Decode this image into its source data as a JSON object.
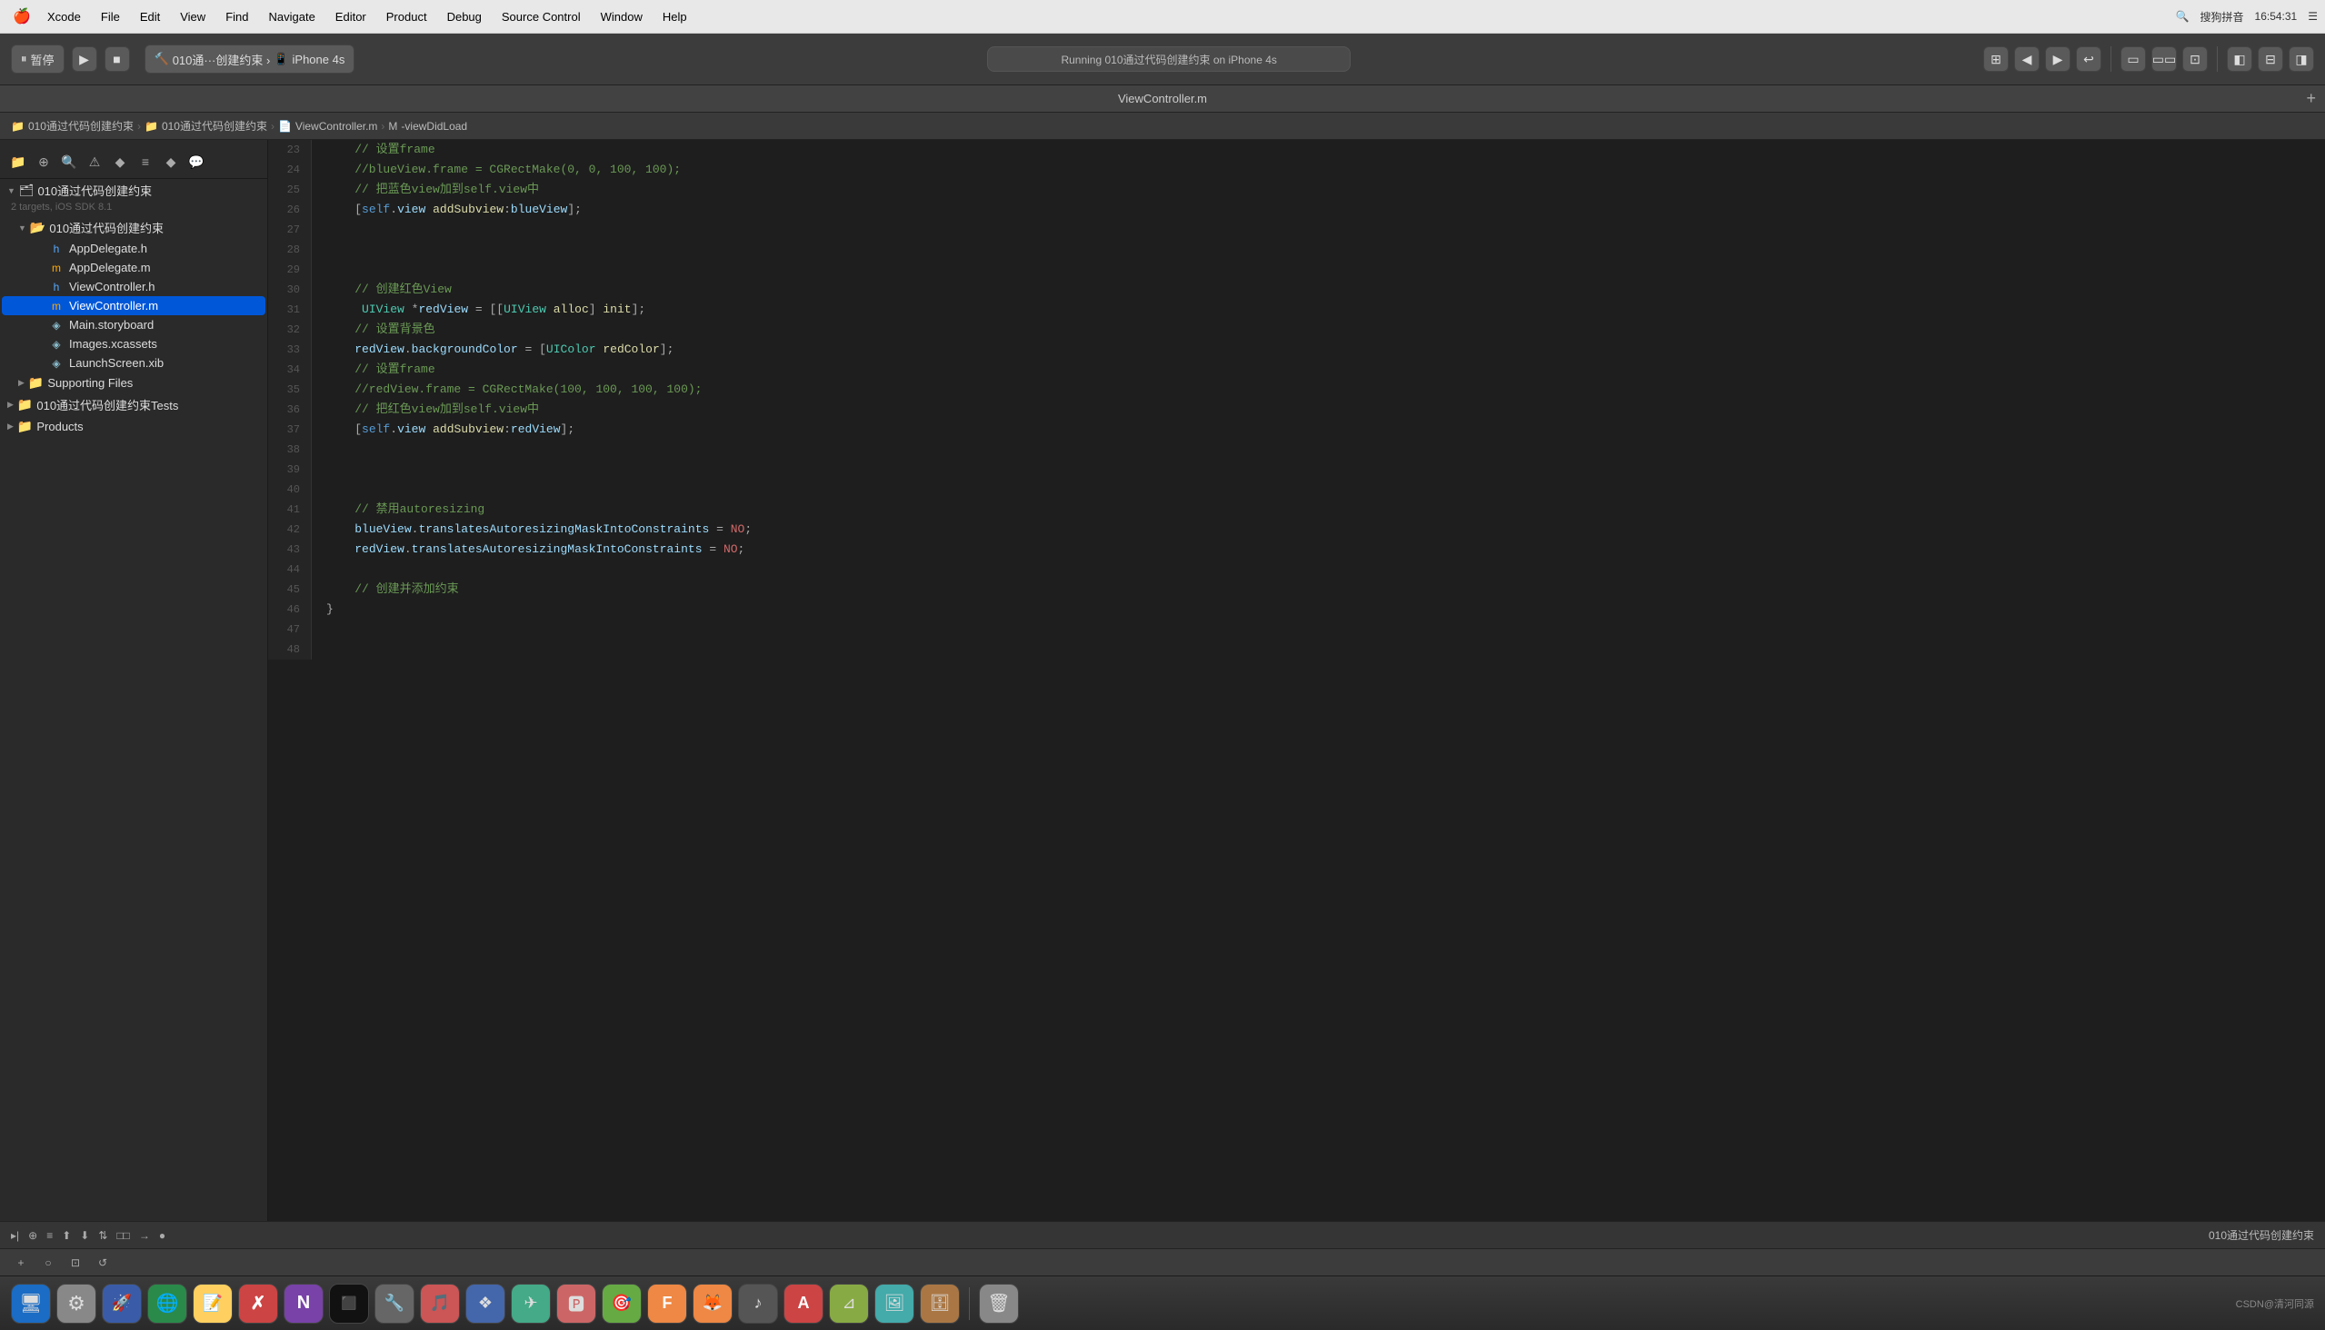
{
  "menubar": {
    "apple": "🍎",
    "items": [
      "Xcode",
      "File",
      "Edit",
      "View",
      "Find",
      "Navigate",
      "Editor",
      "Product",
      "Debug",
      "Source Control",
      "Window",
      "Help"
    ],
    "right": {
      "time": "16:54:31",
      "input_method": "搜狗拼音"
    }
  },
  "toolbar": {
    "stop_label": "暂停",
    "run_icon": "▶",
    "stop_icon": "■",
    "device": "iPhone 4s",
    "status": "Running 010通过代码创建约束 on iPhone 4s",
    "icons": [
      "⊞",
      "◀",
      "▶",
      "≡",
      "⊙",
      "□",
      "⊡",
      "▦"
    ]
  },
  "tabbar": {
    "title": "ViewController.m",
    "add": "+"
  },
  "breadcrumb": {
    "items": [
      "010通过代码创建约束",
      "010通过代码创建约束",
      "ViewController.m",
      "-viewDidLoad"
    ]
  },
  "sidebar": {
    "toolbar_icons": [
      "📁",
      "⊕",
      "🔍",
      "⚠",
      "◆",
      "≡",
      "♦",
      "💬"
    ],
    "project": {
      "name": "010通过代码创建约束",
      "meta": "2 targets, iOS SDK 8.1",
      "groups": [
        {
          "name": "010通过代码创建约束",
          "expanded": true,
          "items": [
            {
              "name": "AppDelegate.h",
              "icon": "h",
              "type": "header"
            },
            {
              "name": "AppDelegate.m",
              "icon": "m",
              "type": "source"
            },
            {
              "name": "ViewController.h",
              "icon": "h",
              "type": "header"
            },
            {
              "name": "ViewController.m",
              "icon": "m",
              "type": "source",
              "selected": true
            },
            {
              "name": "Main.storyboard",
              "icon": "◈",
              "type": "storyboard"
            },
            {
              "name": "Images.xcassets",
              "icon": "◈",
              "type": "assets"
            },
            {
              "name": "LaunchScreen.xib",
              "icon": "◈",
              "type": "xib"
            }
          ]
        },
        {
          "name": "Supporting Files",
          "expanded": false,
          "items": []
        },
        {
          "name": "010通过代码创建约束Tests",
          "expanded": false,
          "items": []
        },
        {
          "name": "Products",
          "expanded": false,
          "items": []
        }
      ]
    }
  },
  "editor": {
    "lines": [
      {
        "num": 23,
        "content": "    // 设置frame",
        "type": "comment"
      },
      {
        "num": 24,
        "content": "    //blueView.frame = CGRectMake(0, 0, 100, 100);",
        "type": "comment"
      },
      {
        "num": 25,
        "content": "    // 把蓝色view加到self.view中",
        "type": "comment"
      },
      {
        "num": 26,
        "content": "    [self.view addSubview:blueView];",
        "type": "code"
      },
      {
        "num": 27,
        "content": ""
      },
      {
        "num": 28,
        "content": ""
      },
      {
        "num": 29,
        "content": ""
      },
      {
        "num": 30,
        "content": "    // 创建红色View",
        "type": "comment"
      },
      {
        "num": 31,
        "content": "     UIView *redView = [[UIView alloc] init];",
        "type": "code"
      },
      {
        "num": 32,
        "content": "    // 设置背景色",
        "type": "comment"
      },
      {
        "num": 33,
        "content": "    redView.backgroundColor = [UIColor redColor];",
        "type": "code"
      },
      {
        "num": 34,
        "content": "    // 设置frame",
        "type": "comment"
      },
      {
        "num": 35,
        "content": "    //redView.frame = CGRectMake(100, 100, 100, 100);",
        "type": "comment"
      },
      {
        "num": 36,
        "content": "    // 把红色view加到self.view中",
        "type": "comment"
      },
      {
        "num": 37,
        "content": "    [self.view addSubview:redView];",
        "type": "code"
      },
      {
        "num": 38,
        "content": ""
      },
      {
        "num": 39,
        "content": ""
      },
      {
        "num": 40,
        "content": ""
      },
      {
        "num": 41,
        "content": "    // 禁用autoresizing",
        "type": "comment"
      },
      {
        "num": 42,
        "content": "    blueView.translatesAutoresizingMaskIntoConstraints = NO;",
        "type": "code"
      },
      {
        "num": 43,
        "content": "    redView.translatesAutoresizingMaskIntoConstraints = NO;",
        "type": "code"
      },
      {
        "num": 44,
        "content": ""
      },
      {
        "num": 45,
        "content": "    // 创建并添加约束",
        "type": "comment"
      },
      {
        "num": 46,
        "content": "}"
      },
      {
        "num": 47,
        "content": ""
      },
      {
        "num": 48,
        "content": ""
      }
    ]
  },
  "debug_bar": {
    "icons": [
      "▸|",
      "⊕",
      "📋",
      "⬆",
      "⬇",
      "⇅",
      "□□",
      "→",
      "●"
    ],
    "project_name": "010通过代码创建约束"
  },
  "bottombar": {
    "icons": [
      "+",
      "○",
      "⊡",
      "↺"
    ]
  },
  "dock": {
    "items": [
      {
        "icon": "🖥",
        "label": "Finder",
        "color": "#4a90d9"
      },
      {
        "icon": "⚙",
        "label": "SystemPrefs",
        "color": "#888"
      },
      {
        "icon": "🚀",
        "label": "Launchpad",
        "color": "#5a7"
      },
      {
        "icon": "🌐",
        "label": "Safari",
        "color": "#3a8"
      },
      {
        "icon": "📝",
        "label": "Notes",
        "color": "#ffd"
      },
      {
        "icon": "✗",
        "label": "XcodeExt",
        "color": "#c44"
      },
      {
        "icon": "N",
        "label": "OneNote",
        "color": "#7a4"
      },
      {
        "icon": "⬛",
        "label": "Terminal",
        "color": "#222"
      },
      {
        "icon": "⚒",
        "label": "Tools",
        "color": "#666"
      },
      {
        "icon": "🎵",
        "label": "Music",
        "color": "#c55"
      },
      {
        "icon": "❖",
        "label": "App1",
        "color": "#46a"
      },
      {
        "icon": "✈",
        "label": "App2",
        "color": "#4a8"
      },
      {
        "icon": "📦",
        "label": "App3",
        "color": "#a64"
      },
      {
        "icon": "🎯",
        "label": "App4",
        "color": "#a44"
      },
      {
        "icon": "F",
        "label": "FileZilla",
        "color": "#c84"
      },
      {
        "icon": "🦊",
        "label": "App5",
        "color": "#e84"
      },
      {
        "icon": "♪",
        "label": "App6",
        "color": "#555"
      },
      {
        "icon": "A",
        "label": "App7",
        "color": "#c44"
      },
      {
        "icon": "⊿",
        "label": "App8",
        "color": "#8a4"
      },
      {
        "icon": "🖼",
        "label": "Preview",
        "color": "#4aa"
      },
      {
        "icon": "🗄",
        "label": "App9",
        "color": "#a74"
      },
      {
        "icon": "🗑",
        "label": "Trash",
        "color": "#888"
      }
    ],
    "right_text": "CSDN@清河同源"
  }
}
